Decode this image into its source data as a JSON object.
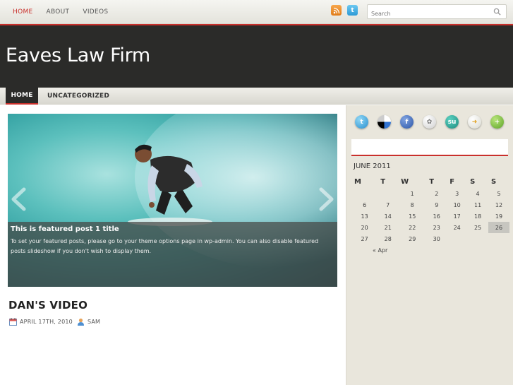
{
  "topnav": {
    "items": [
      {
        "label": "HOME",
        "active": true
      },
      {
        "label": "ABOUT",
        "active": false
      },
      {
        "label": "VIDEOS",
        "active": false
      }
    ]
  },
  "top_social": {
    "icons": [
      "rss-icon",
      "twitter-icon"
    ]
  },
  "search": {
    "placeholder": "Search",
    "icon": "search-icon"
  },
  "site": {
    "title": "Eaves Law Firm"
  },
  "mainnav": {
    "home": "HOME",
    "uncategorized": "UNCATEGORIZED"
  },
  "featured": {
    "title": "This is featured post 1 title",
    "text": "To set your featured posts, please go to your theme options page in wp-admin. You can also disable featured posts slideshow if you don't wish to display them."
  },
  "post": {
    "title": "DAN'S VIDEO",
    "date": "APRIL 17TH, 2010",
    "author": "SAM"
  },
  "sidebar": {
    "social_icons": [
      "twitter-icon",
      "delicious-icon",
      "facebook-icon",
      "myspace-icon",
      "stumbleupon-icon",
      "reddit-icon",
      "add-icon"
    ],
    "calendar": {
      "caption": "JUNE 2011",
      "headers": [
        "M",
        "T",
        "W",
        "T",
        "F",
        "S",
        "S"
      ],
      "rows": [
        [
          "",
          "",
          "1",
          "2",
          "3",
          "4",
          "5"
        ],
        [
          "6",
          "7",
          "8",
          "9",
          "10",
          "11",
          "12"
        ],
        [
          "13",
          "14",
          "15",
          "16",
          "17",
          "18",
          "19"
        ],
        [
          "20",
          "21",
          "22",
          "23",
          "24",
          "25",
          "26"
        ],
        [
          "27",
          "28",
          "29",
          "30",
          "",
          "",
          ""
        ]
      ],
      "today": "26",
      "prev_link": "« Apr"
    }
  },
  "colors": {
    "accent": "#c9302c",
    "header_bg": "#2b2b29",
    "sidebar_bg": "#e9e6dc"
  }
}
